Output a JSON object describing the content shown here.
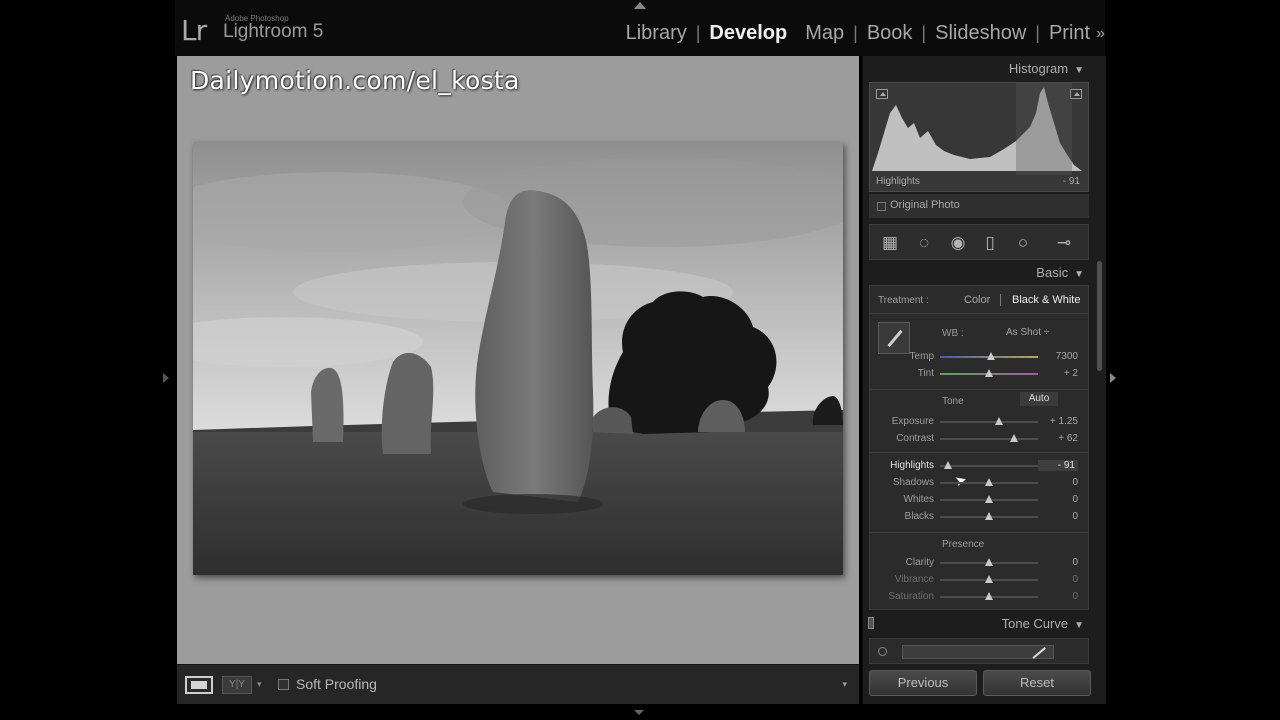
{
  "app": {
    "logo": "Lr",
    "vendor": "Adobe Photoshop",
    "product": "Lightroom 5"
  },
  "modules": {
    "items": [
      "Library",
      "Develop",
      "Map",
      "Book",
      "Slideshow",
      "Print"
    ],
    "active": "Develop",
    "more": "»"
  },
  "viewer": {
    "watermark": "Dailymotion.com/el_kosta"
  },
  "toolbar": {
    "compare_label": "Y|Y",
    "caret": "▾",
    "soft_proofing": "Soft Proofing",
    "menu": "▾"
  },
  "histogram": {
    "title": "Histogram",
    "readout_label": "Highlights",
    "readout_value": "- 91",
    "original_photo": "Original Photo"
  },
  "basic": {
    "title": "Basic",
    "treatment_label": "Treatment :",
    "treatment_color": "Color",
    "treatment_bw": "Black & White",
    "wb_label": "WB :",
    "wb_value": "As Shot ÷",
    "tone_head": "Tone",
    "auto_label": "Auto",
    "presence_head": "Presence",
    "sliders": {
      "temp": {
        "label": "Temp",
        "value": "7300",
        "pos": 0.52
      },
      "tint": {
        "label": "Tint",
        "value": "+ 2",
        "pos": 0.5
      },
      "exposure": {
        "label": "Exposure",
        "value": "+ 1.25",
        "pos": 0.6
      },
      "contrast": {
        "label": "Contrast",
        "value": "+ 62",
        "pos": 0.76
      },
      "highlights": {
        "label": "Highlights",
        "value": "- 91",
        "pos": 0.08
      },
      "shadows": {
        "label": "Shadows",
        "value": "0",
        "pos": 0.5
      },
      "whites": {
        "label": "Whites",
        "value": "0",
        "pos": 0.5
      },
      "blacks": {
        "label": "Blacks",
        "value": "0",
        "pos": 0.5
      },
      "clarity": {
        "label": "Clarity",
        "value": "0",
        "pos": 0.5
      },
      "vibrance": {
        "label": "Vibrance",
        "value": "0",
        "pos": 0.5
      },
      "saturation": {
        "label": "Saturation",
        "value": "0",
        "pos": 0.5
      }
    }
  },
  "tone_curve": {
    "title": "Tone Curve"
  },
  "buttons": {
    "previous": "Previous",
    "reset": "Reset"
  }
}
